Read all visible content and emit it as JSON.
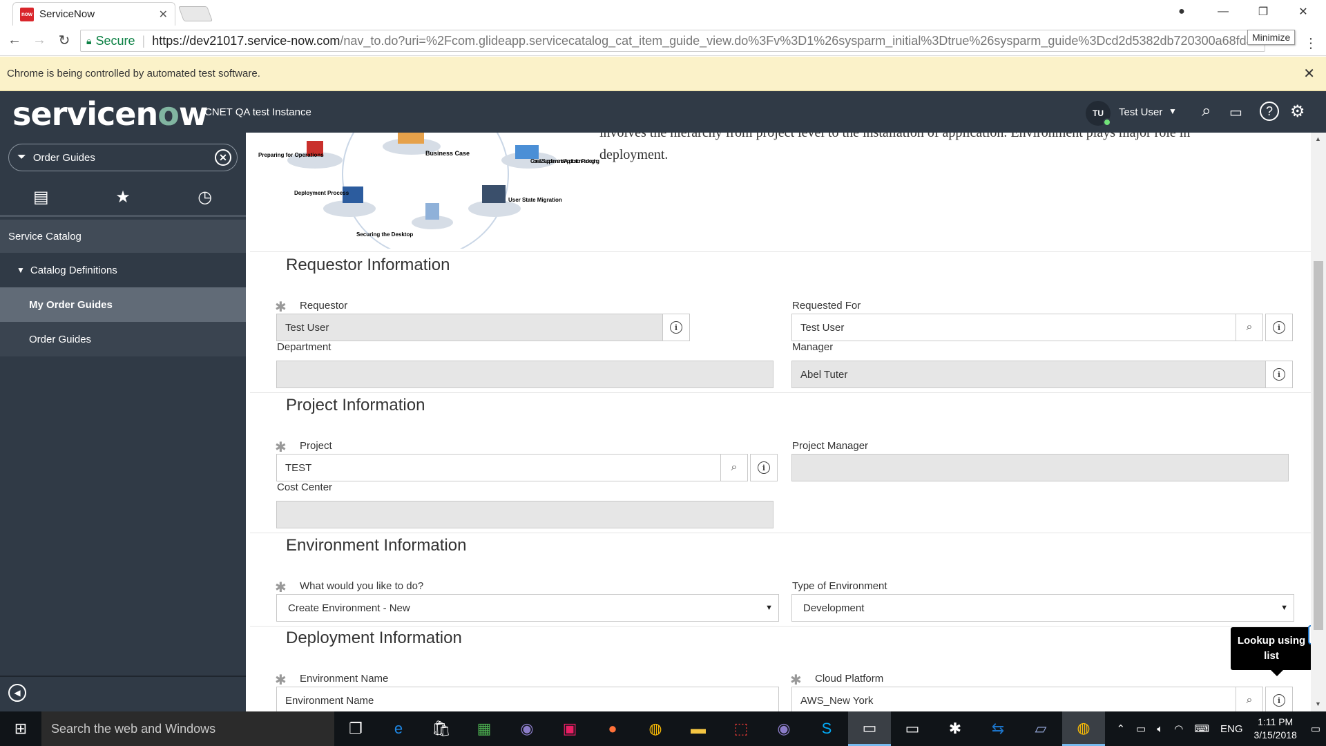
{
  "browser": {
    "tab_title": "ServiceNow",
    "tab_favicon": "now",
    "url_secure_label": "Secure",
    "url_host": "https://dev21017.service-now.com",
    "url_path": "/nav_to.do?uri=%2Fcom.glideapp.servicecatalog_cat_item_guide_view.do%3Fv%3D1%26sysparm_initial%3Dtrue%26sysparm_guide%3Dcd2d5382db720300a68fda11cf9...",
    "minimize_tooltip": "Minimize",
    "infobar_text": "Chrome is being controlled by automated test software."
  },
  "header": {
    "logo_main": "servicen",
    "logo_accent": "o",
    "logo_end": "w",
    "instance_name": "CNET QA test Instance",
    "avatar_initials": "TU",
    "user_name": "Test User"
  },
  "nav": {
    "filter_value": "Order Guides",
    "section": "Service Catalog",
    "items": [
      {
        "label": "Catalog Definitions"
      },
      {
        "label": "My Order Guides"
      },
      {
        "label": "Order Guides"
      }
    ]
  },
  "diagram": {
    "labels": [
      "Preparing for Operations",
      "Business Case",
      "Core & Supplemental Application Packaging",
      "Deployment Process",
      "User State Migration",
      "Securing the Desktop"
    ]
  },
  "intro": {
    "line1": "involves the hierarchy from project level to the installation of application. Environment plays major role in",
    "line2": "deployment."
  },
  "sections": {
    "requestor": {
      "title": "Requestor Information",
      "requestor_label": "Requestor",
      "requestor_value": "Test User",
      "requested_for_label": "Requested For",
      "requested_for_value": "Test User",
      "department_label": "Department",
      "department_value": "",
      "manager_label": "Manager",
      "manager_value": "Abel Tuter"
    },
    "project": {
      "title": "Project Information",
      "project_label": "Project",
      "project_value": "TEST",
      "project_manager_label": "Project Manager",
      "project_manager_value": "",
      "cost_center_label": "Cost Center",
      "cost_center_value": ""
    },
    "environment": {
      "title": "Environment Information",
      "action_label": "What would you like to do?",
      "action_value": "Create Environment - New",
      "type_label": "Type of Environment",
      "type_value": "Development"
    },
    "deployment": {
      "title": "Deployment Information",
      "env_name_label": "Environment Name",
      "env_name_value": "Environment Name",
      "cloud_label": "Cloud Platform",
      "cloud_value": "AWS_New York",
      "lookup_tooltip": "Lookup using list"
    }
  },
  "taskbar": {
    "search_placeholder": "Search the web and Windows",
    "language": "ENG",
    "time": "1:11 PM",
    "date": "3/15/2018"
  }
}
